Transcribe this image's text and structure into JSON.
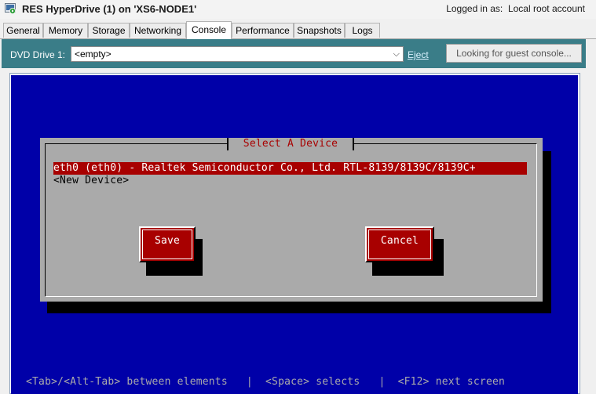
{
  "window": {
    "title": "RES HyperDrive (1) on 'XS6-NODE1'",
    "login_label": "Logged in as:",
    "login_value": "Local root account",
    "icon": "vm-running-icon"
  },
  "tabs": [
    {
      "label": "General",
      "active": false
    },
    {
      "label": "Memory",
      "active": false
    },
    {
      "label": "Storage",
      "active": false
    },
    {
      "label": "Networking",
      "active": false
    },
    {
      "label": "Console",
      "active": true
    },
    {
      "label": "Performance",
      "active": false
    },
    {
      "label": "Snapshots",
      "active": false
    },
    {
      "label": "Logs",
      "active": false
    }
  ],
  "toolbar": {
    "dvd_label": "DVD Drive 1:",
    "dvd_value": "<empty>",
    "eject_label": "Eject",
    "console_button_label": "Looking for guest console..."
  },
  "console": {
    "dialog_title": "Select A Device",
    "devices": [
      {
        "label": "eth0 (eth0) - Realtek Semiconductor Co., Ltd. RTL-8139/8139C/8139C+",
        "selected": true
      },
      {
        "label": "<New Device>",
        "selected": false
      }
    ],
    "save_label": "Save",
    "cancel_label": "Cancel",
    "status_line": "<Tab>/<Alt-Tab> between elements   |  <Space> selects   |  <F12> next screen"
  },
  "colors": {
    "console_bg": "#0000a8",
    "dialog_bg": "#aaaaaa",
    "accent_red": "#a80000",
    "toolbar_bg": "#3a7d88"
  }
}
